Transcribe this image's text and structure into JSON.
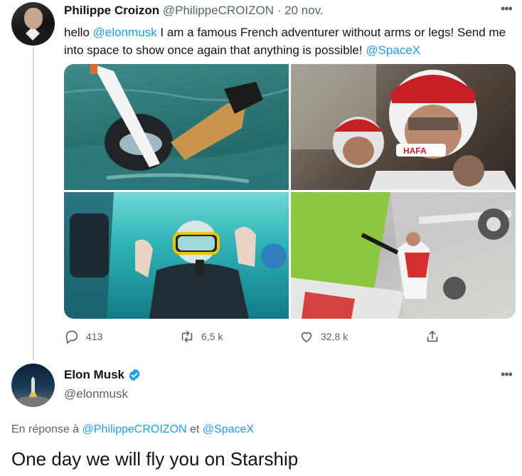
{
  "tweet1": {
    "author_name": "Philippe Croizon",
    "author_handle": "@PhilippeCROIZON",
    "separator": "·",
    "date": "20 nov.",
    "text_parts": {
      "p1": "hello ",
      "mention1": "@elonmusk",
      "p2": " I am a famous French adventurer without arms or legs! Send me into space to show once again that anything is possible! ",
      "mention2": "@SpaceX"
    },
    "stats": {
      "replies": "413",
      "retweets": "6,5 k",
      "likes": "32,8 k"
    }
  },
  "tweet2": {
    "author_name": "Elon Musk",
    "author_handle": "@elonmusk",
    "reply_prefix": "En réponse à ",
    "reply_mention1": "@PhilippeCROIZON",
    "reply_and": " et ",
    "reply_mention2": "@SpaceX",
    "text": "One day we will fly you on Starship"
  },
  "icons": {
    "more": "more-icon",
    "reply": "reply-icon",
    "retweet": "retweet-icon",
    "like": "heart-icon",
    "share": "share-icon",
    "verified": "verified-badge-icon"
  },
  "colors": {
    "accent": "#1d9bf0",
    "muted": "#536471",
    "text": "#0f1419",
    "line": "#cfd9de"
  }
}
